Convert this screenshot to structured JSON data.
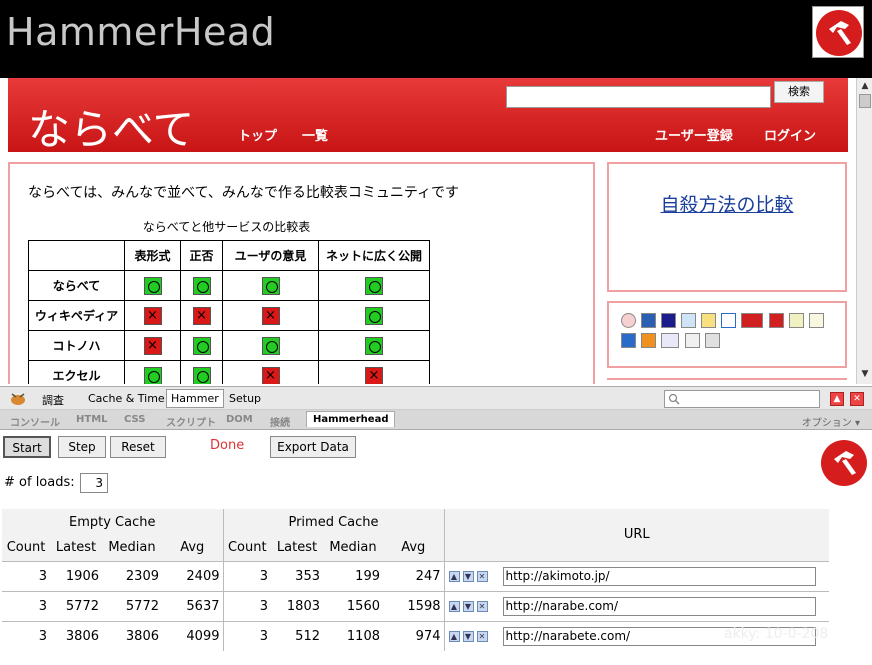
{
  "app": {
    "title": "HammerHead",
    "logo": "hammerhead-logo"
  },
  "site": {
    "logo": "ならべて",
    "nav": [
      "トップ",
      "一覧"
    ],
    "nav_right": [
      "ユーザー登録",
      "ログイン"
    ],
    "search_button": "検索",
    "headline": "ならべては、みんなで並べて、みんなで作る比較表コミュニティです",
    "table_caption": "ならべてと他サービスの比較表",
    "table_headers": [
      "",
      "表形式",
      "正否",
      "ユーザの意見",
      "ネットに広く公開"
    ],
    "table_rows": [
      {
        "name": "ならべて",
        "marks": [
          "ok",
          "ok",
          "ok",
          "ok"
        ]
      },
      {
        "name": "ウィキペディア",
        "marks": [
          "ng",
          "ng",
          "ng",
          "ok"
        ]
      },
      {
        "name": "コトノハ",
        "marks": [
          "ng",
          "ok",
          "ok",
          "ok"
        ]
      },
      {
        "name": "エクセル",
        "marks": [
          "ok",
          "ok",
          "ng",
          "ng"
        ]
      }
    ],
    "side_link": "自殺方法の比較"
  },
  "firebug": {
    "inspect": "調査",
    "toolbar_tabs": [
      "Cache & Time",
      "Hammer",
      "Setup"
    ],
    "active_toolbar_tab": "Hammer",
    "panel_tabs": [
      "コンソール",
      "HTML",
      "CSS",
      "スクリプト",
      "DOM",
      "接続",
      "Hammerhead"
    ],
    "active_panel_tab": "Hammerhead",
    "options": "オプション ▾"
  },
  "hammerhead": {
    "buttons": {
      "start": "Start",
      "step": "Step",
      "reset": "Reset",
      "export": "Export Data"
    },
    "status": "Done",
    "loads_label": "# of loads:",
    "loads_value": "3",
    "group_headers": {
      "empty": "Empty Cache",
      "primed": "Primed Cache",
      "url": "URL"
    },
    "columns": [
      "Count",
      "Latest",
      "Median",
      "Avg",
      "Count",
      "Latest",
      "Median",
      "Avg"
    ],
    "rows": [
      {
        "empty": [
          "3",
          "1906",
          "2309",
          "2409"
        ],
        "primed": [
          "3",
          "353",
          "199",
          "247"
        ],
        "url": "http://akimoto.jp/"
      },
      {
        "empty": [
          "3",
          "5772",
          "5772",
          "5637"
        ],
        "primed": [
          "3",
          "1803",
          "1560",
          "1598"
        ],
        "url": "http://narabe.com/"
      },
      {
        "empty": [
          "3",
          "3806",
          "3806",
          "4099"
        ],
        "primed": [
          "3",
          "512",
          "1108",
          "974"
        ],
        "url": "http://narabete.com/"
      }
    ]
  },
  "watermark": "akky: 10-0-208",
  "colors": {
    "brand_red": "#d61d1d",
    "header_red": "#c81414",
    "status_red": "#dd3333",
    "link_blue": "#1a3e9c"
  }
}
